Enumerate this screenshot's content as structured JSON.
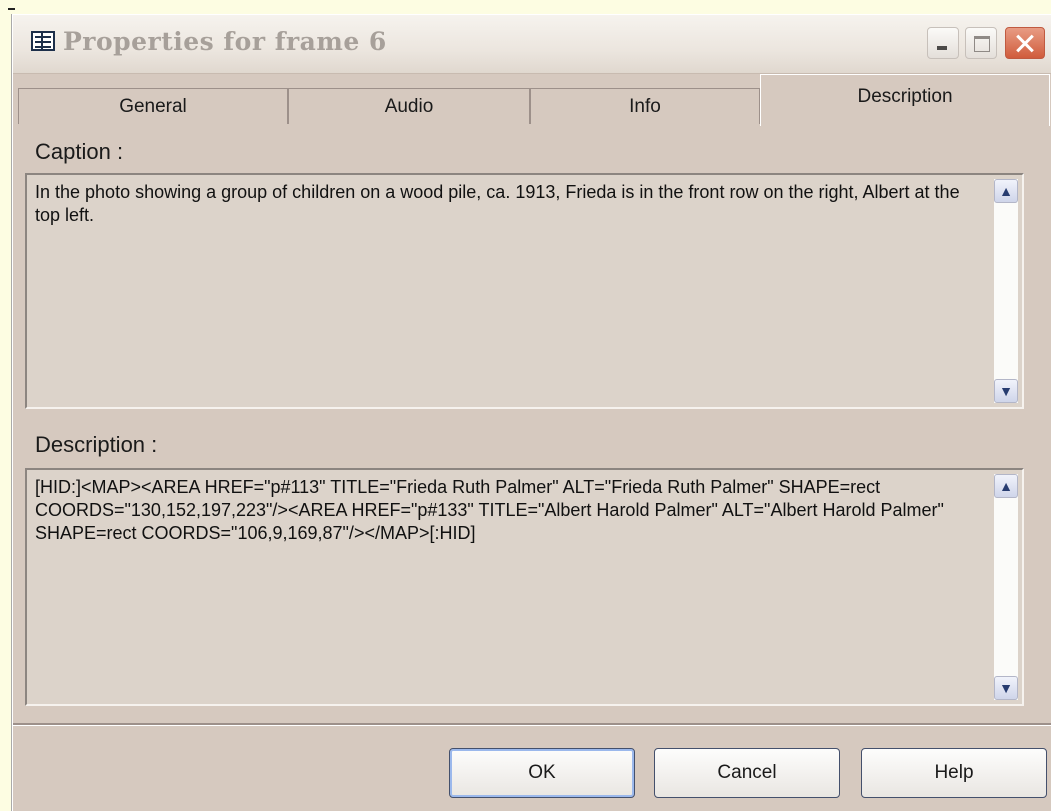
{
  "window": {
    "title": "Properties for frame 6",
    "icon": "properties-icon"
  },
  "tabs": [
    {
      "label": "General"
    },
    {
      "label": "Audio"
    },
    {
      "label": "Info"
    },
    {
      "label": "Description",
      "selected": true
    }
  ],
  "caption": {
    "label": "Caption :",
    "text": "In the photo showing a group of children on a wood pile, ca. 1913, Frieda is in the front row on the right, Albert at the top left."
  },
  "description": {
    "label": "Description :",
    "text": "[HID:]<MAP><AREA HREF=\"p#113\" TITLE=\"Frieda Ruth Palmer\" ALT=\"Frieda Ruth Palmer\" SHAPE=rect COORDS=\"130,152,197,223\"/><AREA HREF=\"p#133\" TITLE=\"Albert Harold Palmer\" ALT=\"Albert Harold Palmer\" SHAPE=rect COORDS=\"106,9,169,87\"/></MAP>[:HID]"
  },
  "buttons": {
    "ok": "OK",
    "cancel": "Cancel",
    "help": "Help"
  }
}
